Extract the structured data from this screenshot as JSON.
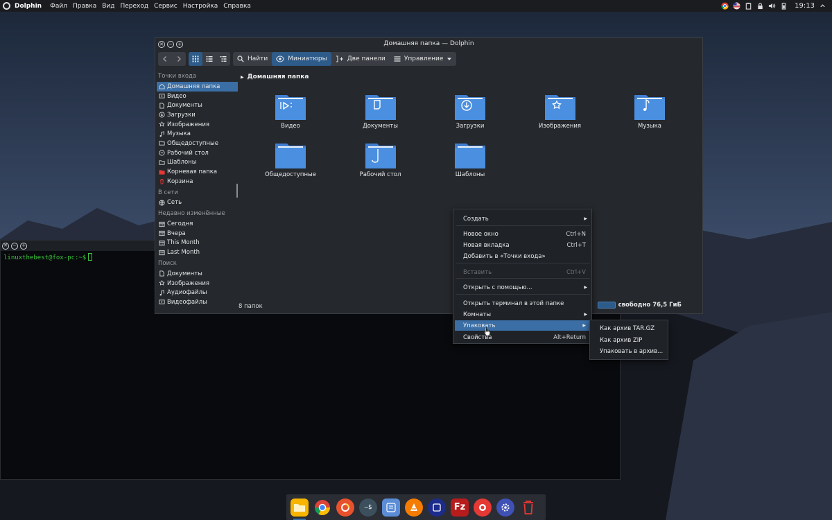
{
  "top_panel": {
    "app_name": "Dolphin",
    "menu": [
      "Файл",
      "Правка",
      "Вид",
      "Переход",
      "Сервис",
      "Настройка",
      "Справка"
    ],
    "clock": "19:13"
  },
  "terminal": {
    "prompt": "linuxthebest@fox-pc:~$"
  },
  "dolphin": {
    "title": "Домашняя папка — Dolphin",
    "toolbar": {
      "find": "Найти",
      "preview": "Миниатюры",
      "split": "Две панели",
      "control": "Управление"
    },
    "sidebar": {
      "places_header": "Точки входа",
      "places": [
        {
          "label": "Домашняя папка",
          "icon": "home-icon"
        },
        {
          "label": "Видео",
          "icon": "video-icon"
        },
        {
          "label": "Документы",
          "icon": "document-icon"
        },
        {
          "label": "Загрузки",
          "icon": "download-icon"
        },
        {
          "label": "Изображения",
          "icon": "image-icon"
        },
        {
          "label": "Музыка",
          "icon": "music-icon"
        },
        {
          "label": "Общедоступные",
          "icon": "folder-icon"
        },
        {
          "label": "Рабочий стол",
          "icon": "desktop-icon"
        },
        {
          "label": "Шаблоны",
          "icon": "folder-icon"
        },
        {
          "label": "Корневая папка",
          "icon": "root-folder-icon"
        },
        {
          "label": "Корзина",
          "icon": "trash-icon"
        }
      ],
      "network_header": "В сети",
      "network": [
        {
          "label": "Сеть",
          "icon": "network-icon"
        }
      ],
      "recent_header": "Недавно изменённые",
      "recent": [
        {
          "label": "Сегодня",
          "icon": "calendar-icon"
        },
        {
          "label": "Вчера",
          "icon": "calendar-icon"
        },
        {
          "label": "This Month",
          "icon": "calendar-icon"
        },
        {
          "label": "Last Month",
          "icon": "calendar-icon"
        }
      ],
      "search_header": "Поиск",
      "search": [
        {
          "label": "Документы",
          "icon": "document-icon"
        },
        {
          "label": "Изображения",
          "icon": "image-icon"
        },
        {
          "label": "Аудиофайлы",
          "icon": "music-icon"
        },
        {
          "label": "Видеофайлы",
          "icon": "video-icon"
        }
      ]
    },
    "location": "Домашняя папка",
    "folders": [
      {
        "label": "Видео",
        "icon": "video-icon"
      },
      {
        "label": "Документы",
        "icon": "document-icon"
      },
      {
        "label": "Загрузки",
        "icon": "download-icon"
      },
      {
        "label": "Изображения",
        "icon": "image-icon"
      },
      {
        "label": "Музыка",
        "icon": "music-icon"
      },
      {
        "label": "Общедоступные",
        "icon": "folder-icon"
      },
      {
        "label": "Рабочий стол",
        "icon": "desktop-icon"
      },
      {
        "label": "Шаблоны",
        "icon": "folder-icon"
      }
    ],
    "status": "8 папок",
    "free_space": "свободно 76,5 ГиБ"
  },
  "context_menu": {
    "items": [
      {
        "label": "Создать",
        "shortcut": "",
        "submenu": true
      },
      {
        "label": "Новое окно",
        "shortcut": "Ctrl+N"
      },
      {
        "label": "Новая вкладка",
        "shortcut": "Ctrl+T"
      },
      {
        "label": "Добавить в «Точки входа»",
        "shortcut": ""
      },
      {
        "label": "Вставить",
        "shortcut": "Ctrl+V",
        "disabled": true
      },
      {
        "label": "Открыть с помощью...",
        "shortcut": "",
        "submenu": true
      },
      {
        "label": "Открыть терминал в этой папке",
        "shortcut": ""
      },
      {
        "label": "Комнаты",
        "shortcut": "",
        "submenu": true
      },
      {
        "label": "Упаковать",
        "shortcut": "",
        "submenu": true,
        "highlighted": true
      },
      {
        "label": "Свойства",
        "shortcut": "Alt+Return"
      }
    ]
  },
  "submenu": {
    "items": [
      "Как архив TAR.GZ",
      "Как архив ZIP",
      "Упаковать в архив..."
    ]
  },
  "dock": {
    "apps": [
      "files-app-icon",
      "chrome-app-icon",
      "firefox-app-icon",
      "terminal-app-icon",
      "notes-app-icon",
      "vlc-app-icon",
      "code-editor-app-icon",
      "filezilla-app-icon",
      "media-app-icon",
      "settings-app-icon",
      "trash-app-icon"
    ]
  },
  "colors": {
    "accent": "#3a6ea5",
    "folder_blue": "#4a8fe0",
    "terminal_green": "#3ec43e"
  }
}
